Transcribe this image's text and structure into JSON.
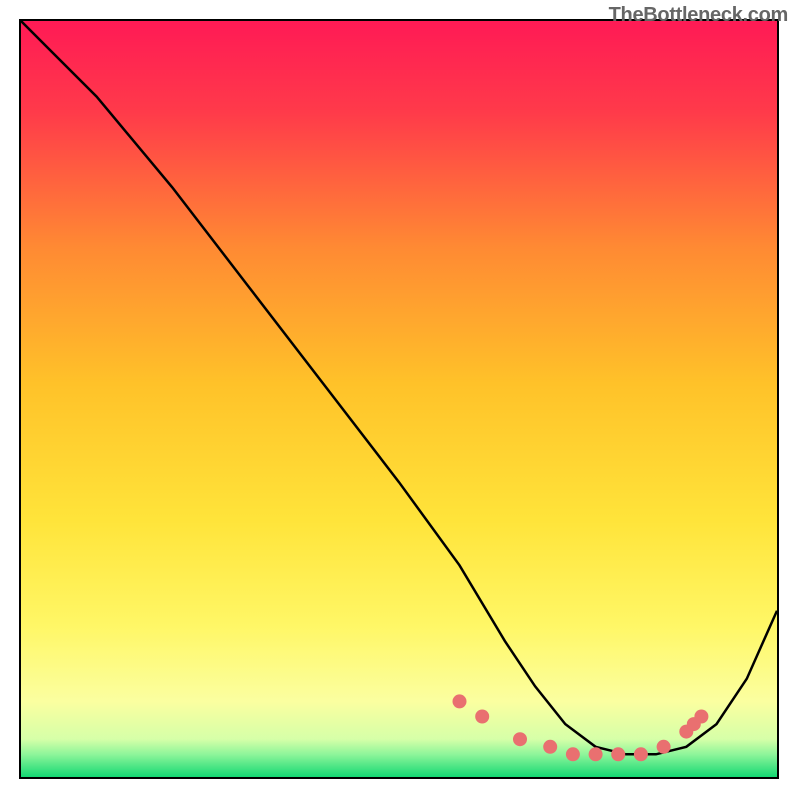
{
  "watermark": "TheBottleneck.com",
  "chart_data": {
    "type": "line",
    "title": "",
    "xlabel": "",
    "ylabel": "",
    "xlim": [
      0,
      100
    ],
    "ylim": [
      0,
      100
    ],
    "grid": false,
    "legend": false,
    "annotations": [],
    "background_gradient": {
      "top": "#ff1a4d",
      "upper": "#ff6a33",
      "mid": "#ffd633",
      "lower": "#ffff80",
      "band": "#f5ffb3",
      "bottom": "#19e07a"
    },
    "series": [
      {
        "name": "curve",
        "color": "#000000",
        "x": [
          0,
          4,
          10,
          20,
          30,
          40,
          50,
          58,
          64,
          68,
          72,
          76,
          80,
          84,
          88,
          92,
          96,
          100
        ],
        "values": [
          100,
          96,
          90,
          78,
          65,
          52,
          39,
          28,
          18,
          12,
          7,
          4,
          3,
          3,
          4,
          7,
          13,
          22
        ]
      }
    ],
    "highlight_points": {
      "color": "#e97070",
      "radius": 7,
      "x": [
        58,
        61,
        66,
        70,
        73,
        76,
        79,
        82,
        85,
        88,
        89,
        90
      ],
      "values": [
        10,
        8,
        5,
        4,
        3,
        3,
        3,
        3,
        4,
        6,
        7,
        8
      ]
    }
  }
}
